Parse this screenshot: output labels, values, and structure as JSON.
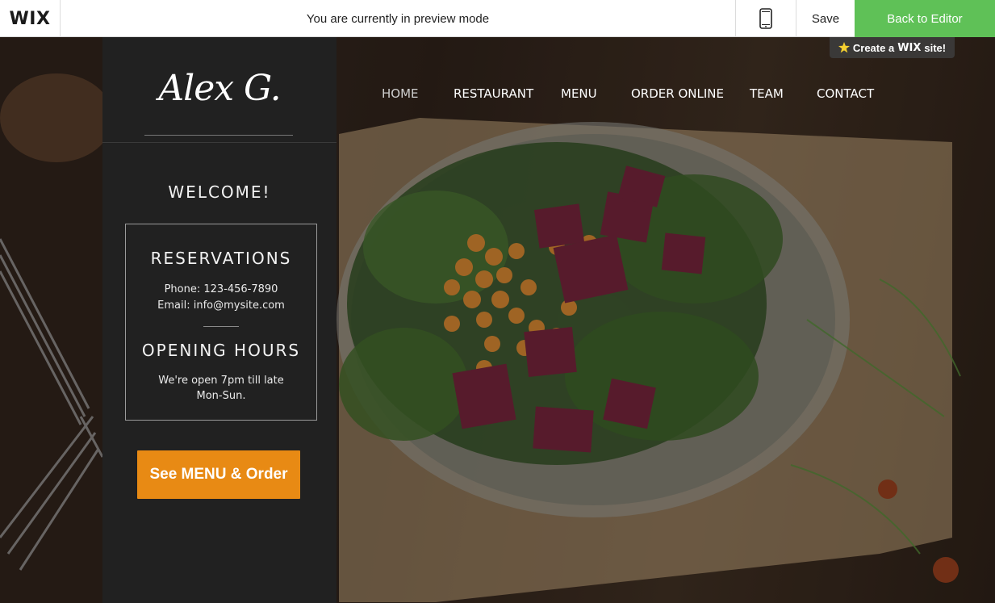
{
  "topbar": {
    "logo": "WIX",
    "preview_message": "You are currently in preview mode",
    "mobile_icon": "mobile-phone-icon",
    "save_label": "Save",
    "back_label": "Back to Editor",
    "accent": "#5fc157"
  },
  "badge": {
    "icon": "star-icon",
    "create_label": "Create a",
    "brand": "WIX",
    "site_label": "site!"
  },
  "site": {
    "signature": "Alex G.",
    "welcome": "WELCOME!",
    "reservations": {
      "heading": "RESERVATIONS",
      "phone": "Phone:  123-456-7890",
      "email": "Email:  info@mysite.com"
    },
    "hours": {
      "heading": "OPENING HOURS",
      "line1": "We're open 7pm till late",
      "line2": "Mon-Sun."
    },
    "cta_label": "See MENU & Order",
    "cta_color": "#e88a14",
    "nav": [
      {
        "label": "HOME",
        "active": true
      },
      {
        "label": "RESTAURANT",
        "active": false
      },
      {
        "label": "MENU",
        "active": false
      },
      {
        "label": "ORDER ONLINE",
        "active": false
      },
      {
        "label": "TEAM",
        "active": false
      },
      {
        "label": "CONTACT",
        "active": false
      }
    ]
  }
}
